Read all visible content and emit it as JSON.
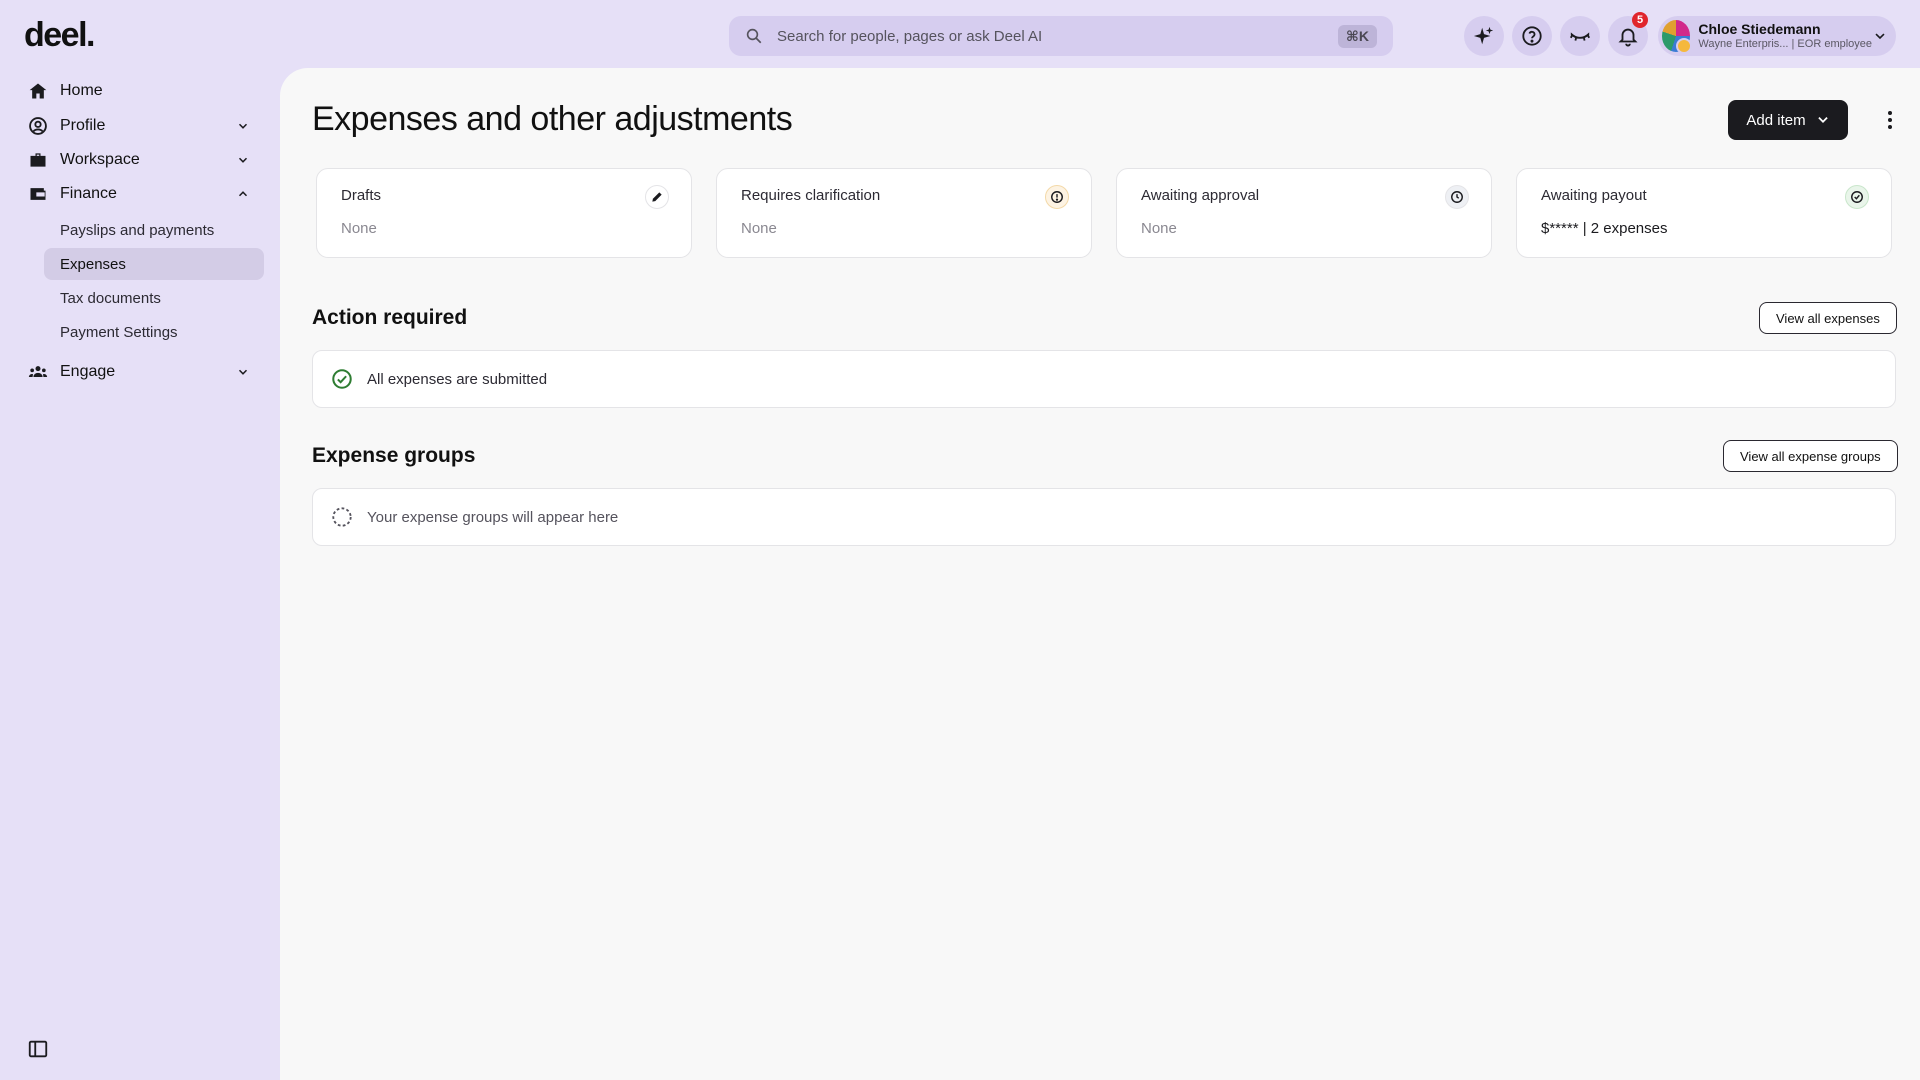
{
  "brand": {
    "logo": "deel."
  },
  "search": {
    "placeholder": "Search for people, pages or ask Deel AI",
    "shortcut": "⌘K"
  },
  "header": {
    "notifications_count": "5",
    "user": {
      "name": "Chloe Stiedemann",
      "subtitle": "Wayne Enterpris... | EOR employee"
    }
  },
  "sidebar": {
    "items": [
      {
        "label": "Home",
        "icon": "home-icon"
      },
      {
        "label": "Profile",
        "icon": "profile-icon"
      },
      {
        "label": "Workspace",
        "icon": "briefcase-icon"
      },
      {
        "label": "Finance",
        "icon": "wallet-icon"
      },
      {
        "label": "Engage",
        "icon": "people-icon"
      }
    ],
    "finance_sub": [
      {
        "label": "Payslips and payments"
      },
      {
        "label": "Expenses",
        "active": true
      },
      {
        "label": "Tax documents"
      },
      {
        "label": "Payment Settings"
      }
    ]
  },
  "main": {
    "title": "Expenses and other adjustments",
    "add_item_label": "Add item",
    "cards": [
      {
        "title": "Drafts",
        "value": "None",
        "icon": "pencil-icon"
      },
      {
        "title": "Requires clarification",
        "value": "None",
        "icon": "alert-icon"
      },
      {
        "title": "Awaiting approval",
        "value": "None",
        "icon": "clock-icon"
      },
      {
        "title": "Awaiting payout",
        "value": "$***** | 2 expenses",
        "icon": "check-circle-icon"
      }
    ],
    "action_required": {
      "title": "Action required",
      "button": "View all expenses",
      "message": "All expenses are submitted"
    },
    "expense_groups": {
      "title": "Expense groups",
      "button": "View all expense groups",
      "message": "Your expense groups will appear here"
    }
  },
  "colors": {
    "background": "#e6e0f7",
    "accent_dark": "#1b1b1f",
    "success": "#2e7d32",
    "warning": "#c9852a",
    "badge": "#e0252c"
  }
}
